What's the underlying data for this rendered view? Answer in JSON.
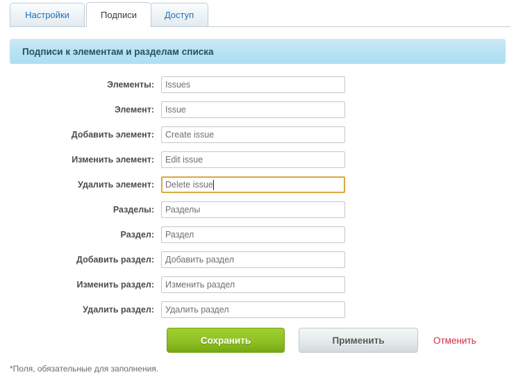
{
  "tabs": [
    {
      "label": "Настройки",
      "active": false
    },
    {
      "label": "Подписи",
      "active": true
    },
    {
      "label": "Доступ",
      "active": false
    }
  ],
  "section": {
    "title": "Подписи к элементам и разделам списка"
  },
  "form": {
    "rows": [
      {
        "label": "Элементы:",
        "value": "Issues",
        "focused": false
      },
      {
        "label": "Элемент:",
        "value": "Issue",
        "focused": false
      },
      {
        "label": "Добавить элемент:",
        "value": "Create issue",
        "focused": false
      },
      {
        "label": "Изменить элемент:",
        "value": "Edit issue",
        "focused": false
      },
      {
        "label": "Удалить элемент:",
        "value": "Delete issue",
        "focused": true
      },
      {
        "label": "Разделы:",
        "value": "Разделы",
        "focused": false
      },
      {
        "label": "Раздел:",
        "value": "Раздел",
        "focused": false
      },
      {
        "label": "Добавить раздел:",
        "value": "Добавить раздел",
        "focused": false
      },
      {
        "label": "Изменить раздел:",
        "value": "Изменить раздел",
        "focused": false
      },
      {
        "label": "Удалить раздел:",
        "value": "Удалить раздел",
        "focused": false
      }
    ]
  },
  "actions": {
    "save_label": "Сохранить",
    "apply_label": "Применить",
    "cancel_label": "Отменить"
  },
  "footnote": {
    "star": "*",
    "text": "Поля, обязательные для заполнения."
  },
  "colors": {
    "save_green": "#8fc024",
    "header_blue": "#b6e2f3",
    "cancel_red": "#cf2b44",
    "focus_amber": "#d9a93d",
    "tab_link_blue": "#1f6fb4"
  }
}
